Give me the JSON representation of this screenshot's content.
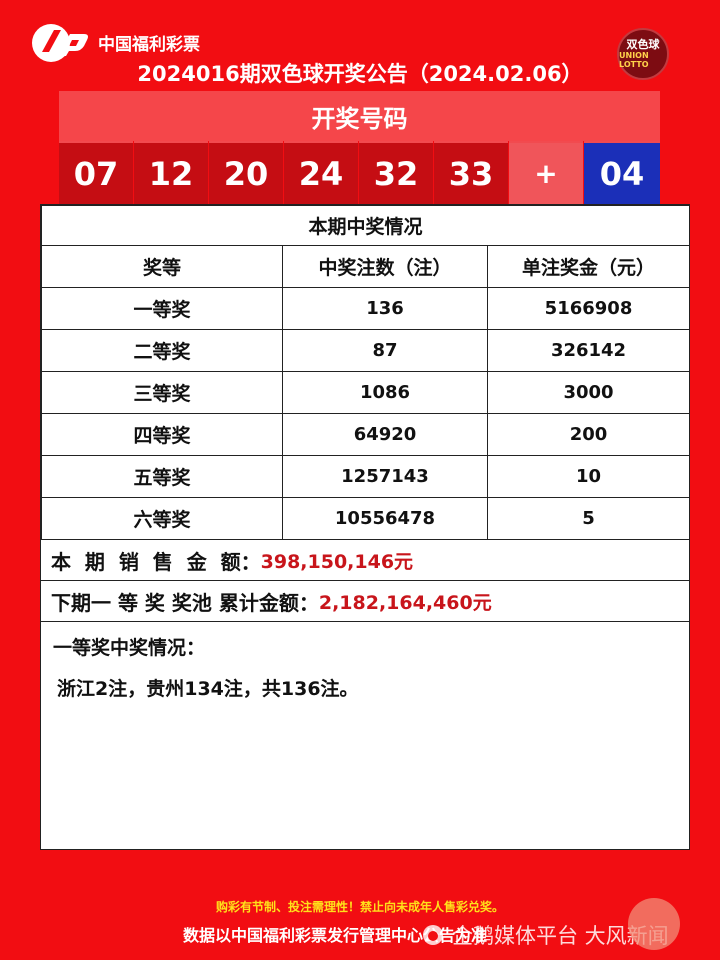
{
  "header": {
    "org_name": "中国福利彩票",
    "title": "2024016期双色球开奖公告（2024.02.06）",
    "badge_line1": "双色球",
    "badge_line2": "UNION LOTTO"
  },
  "draw": {
    "heading": "开奖号码",
    "red_balls": [
      "07",
      "12",
      "20",
      "24",
      "32",
      "33"
    ],
    "plus": "+",
    "blue_ball": "04"
  },
  "prizes": {
    "caption": "本期中奖情况",
    "columns": [
      "奖等",
      "中奖注数（注）",
      "单注奖金（元）"
    ],
    "rows": [
      [
        "一等奖",
        "136",
        "5166908"
      ],
      [
        "二等奖",
        "87",
        "326142"
      ],
      [
        "三等奖",
        "1086",
        "3000"
      ],
      [
        "四等奖",
        "64920",
        "200"
      ],
      [
        "五等奖",
        "1257143",
        "10"
      ],
      [
        "六等奖",
        "10556478",
        "5"
      ]
    ],
    "sales_label": "本  期  销  售  金  额：",
    "sales_value": "398,150,146元",
    "pool_label": "下期一 等 奖 奖池 累计金额：",
    "pool_value": "2,182,164,460元",
    "first_prize_label": "一等奖中奖情况：",
    "first_prize_text": "浙江2注，贵州134注，共136注。"
  },
  "footer": {
    "warning": "购彩有节制、投注需理性！禁止向未成年人售彩兑奖。",
    "source": "数据以中国福利彩票发行管理中心公告为准",
    "watermark": "企鹅媒体平台 大风新闻"
  },
  "colors": {
    "background": "#f20d12",
    "red_ball": "#c50d13",
    "blue_ball": "#1b2fb8",
    "value_red": "#c8151b",
    "warning_yellow": "#ffe01a"
  }
}
